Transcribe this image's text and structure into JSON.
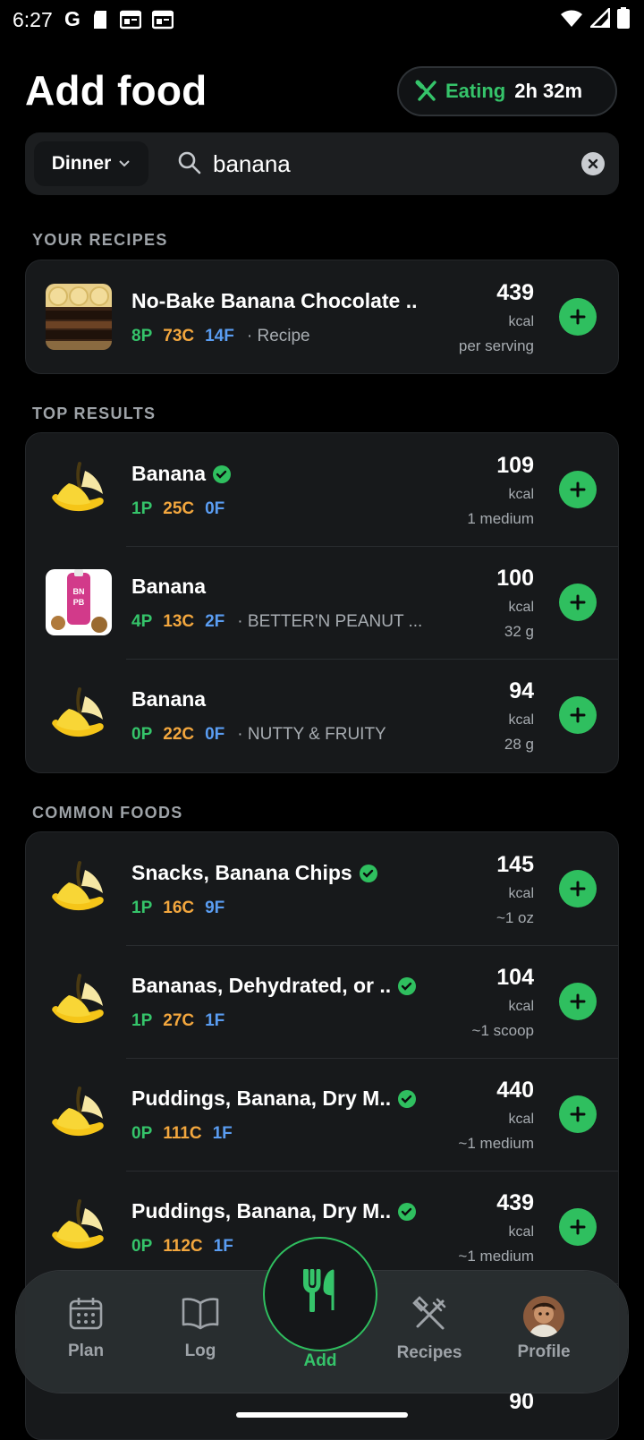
{
  "status": {
    "time": "6:27",
    "g": "G"
  },
  "header": {
    "title": "Add food",
    "eating_label": "Eating",
    "eating_time": "2h 32m"
  },
  "search": {
    "meal": "Dinner",
    "query": "banana"
  },
  "sections": {
    "recipes": "YOUR RECIPES",
    "top": "TOP RESULTS",
    "common": "COMMON FOODS"
  },
  "recipes": [
    {
      "name": "No-Bake Banana Chocolate ..",
      "p": "8P",
      "c": "73C",
      "f": "14F",
      "source": "Recipe",
      "kcal": "439",
      "unit": "kcal",
      "serving": "per serving"
    }
  ],
  "top_results": [
    {
      "name": "Banana",
      "verified": true,
      "p": "1P",
      "c": "25C",
      "f": "0F",
      "source": "",
      "kcal": "109",
      "unit": "kcal",
      "serving": "1 medium"
    },
    {
      "name": "Banana",
      "verified": false,
      "p": "4P",
      "c": "13C",
      "f": "2F",
      "source": "BETTER'N PEANUT ...",
      "kcal": "100",
      "unit": "kcal",
      "serving": "32 g",
      "packet_text": "BN PB"
    },
    {
      "name": "Banana",
      "verified": false,
      "p": "0P",
      "c": "22C",
      "f": "0F",
      "source": "NUTTY & FRUITY",
      "kcal": "94",
      "unit": "kcal",
      "serving": "28 g"
    }
  ],
  "common_foods": [
    {
      "name": "Snacks, Banana Chips",
      "verified": true,
      "p": "1P",
      "c": "16C",
      "f": "9F",
      "kcal": "145",
      "unit": "kcal",
      "serving": "~1 oz"
    },
    {
      "name": "Bananas, Dehydrated, or ..",
      "verified": true,
      "p": "1P",
      "c": "27C",
      "f": "1F",
      "kcal": "104",
      "unit": "kcal",
      "serving": "~1 scoop"
    },
    {
      "name": "Puddings, Banana, Dry M..",
      "verified": true,
      "p": "0P",
      "c": "111C",
      "f": "1F",
      "kcal": "440",
      "unit": "kcal",
      "serving": "~1 medium"
    },
    {
      "name": "Puddings, Banana, Dry M..",
      "verified": true,
      "p": "0P",
      "c": "112C",
      "f": "1F",
      "kcal": "439",
      "unit": "kcal",
      "serving": "~1 medium"
    },
    {
      "name": "",
      "verified": false,
      "p": "",
      "c": "",
      "f": "",
      "kcal": "90",
      "unit": "",
      "serving": ""
    }
  ],
  "tabs": {
    "plan": "Plan",
    "log": "Log",
    "add": "Add",
    "recipes": "Recipes",
    "profile": "Profile"
  },
  "colors": {
    "accent": "#2fbf5f",
    "protein": "#35c46a",
    "carbs": "#f3a73e",
    "fat": "#5a9df2",
    "card": "#17191b"
  },
  "icons": [
    "banana-icon",
    "search-icon",
    "chevron-down-icon",
    "clear-icon",
    "plus-icon",
    "verified-icon",
    "fork-knife-icon",
    "calendar-icon",
    "book-icon",
    "utensils-cross-icon"
  ]
}
